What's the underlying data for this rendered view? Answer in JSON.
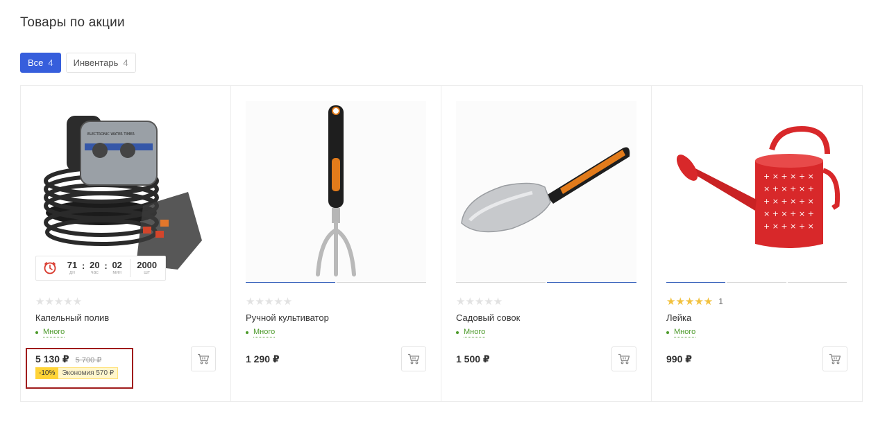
{
  "section_title": "Товары по акции",
  "tabs": [
    {
      "label": "Все",
      "count": "4",
      "active": true
    },
    {
      "label": "Инвентарь",
      "count": "4",
      "active": false
    }
  ],
  "timer": {
    "days": "71",
    "days_label": "дн",
    "hours": "20",
    "hours_label": "час",
    "minutes": "02",
    "minutes_label": "мин",
    "qty": "2000",
    "qty_label": "шт"
  },
  "products": [
    {
      "name": "Капельный полив",
      "image_icon": "drip-irrigation-kit-icon",
      "rating": 0,
      "stock": "Много",
      "price": "5 130 ₽",
      "old_price": "5 700 ₽",
      "discount_pct": "-10%",
      "discount_save": "Экономия 570 ₽"
    },
    {
      "name": "Ручной культиватор",
      "image_icon": "hand-cultivator-icon",
      "rating": 0,
      "stock": "Много",
      "price": "1 290 ₽"
    },
    {
      "name": "Садовый совок",
      "image_icon": "garden-trowel-icon",
      "rating": 0,
      "stock": "Много",
      "price": "1 500 ₽"
    },
    {
      "name": "Лейка",
      "image_icon": "watering-can-icon",
      "rating": 5,
      "rating_count": "1",
      "stock": "Много",
      "price": "990 ₽"
    }
  ],
  "colors": {
    "accent": "#365edc",
    "stock_green": "#4c9a2a",
    "star_gold": "#f2c13d",
    "discount_yellow": "#ffd337"
  }
}
